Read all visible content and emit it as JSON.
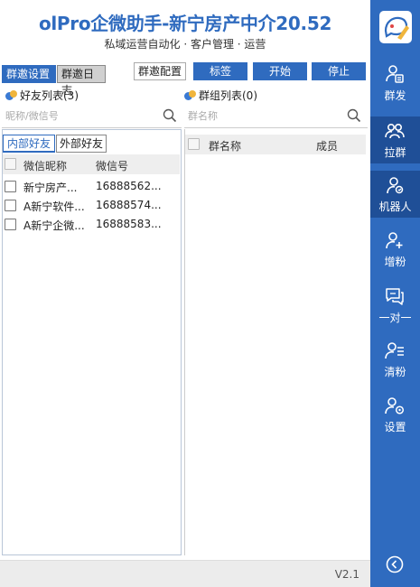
{
  "header": {
    "title": "olPro企微助手-新宁房产中介20.52",
    "subtitle": "私域运营自动化 · 客户管理 · 运营"
  },
  "tabs": [
    {
      "label": "群邀设置",
      "active": true
    },
    {
      "label": "群邀日志",
      "active": false
    }
  ],
  "toolbar": {
    "config_label": "群邀配置",
    "tag_label": "标签",
    "start_label": "开始",
    "stop_label": "停止"
  },
  "friends_panel": {
    "title": "好友列表(3)",
    "search_placeholder": "昵称/微信号",
    "sub_tabs": [
      {
        "label": "内部好友",
        "active": true
      },
      {
        "label": "外部好友",
        "active": false
      }
    ],
    "columns": {
      "nickname": "微信昵称",
      "wechat_id": "微信号"
    },
    "rows": [
      {
        "nickname": "新宁房产...",
        "wechat_id": "16888562..."
      },
      {
        "nickname": "A新宁软件...",
        "wechat_id": "16888574..."
      },
      {
        "nickname": "A新宁企微...",
        "wechat_id": "16888583..."
      }
    ]
  },
  "groups_panel": {
    "title": "群组列表(0)",
    "search_placeholder": "群名称",
    "columns": {
      "group_name": "群名称",
      "members": "成员"
    }
  },
  "status": {
    "version": "V2.1"
  },
  "sidebar": {
    "items": [
      {
        "label": "群发",
        "icon": "group-send-icon",
        "active": false
      },
      {
        "label": "拉群",
        "icon": "pull-group-icon",
        "active": true
      },
      {
        "label": "机器人",
        "icon": "robot-icon",
        "active": true
      },
      {
        "label": "增粉",
        "icon": "add-fans-icon",
        "active": false
      },
      {
        "label": "一对一",
        "icon": "chat-icon",
        "active": false
      },
      {
        "label": "清粉",
        "icon": "clean-fans-icon",
        "active": false
      },
      {
        "label": "设置",
        "icon": "settings-icon",
        "active": false
      }
    ]
  },
  "colors": {
    "accent": "#2f6bbf",
    "sidebar_active": "#1f4f97"
  }
}
